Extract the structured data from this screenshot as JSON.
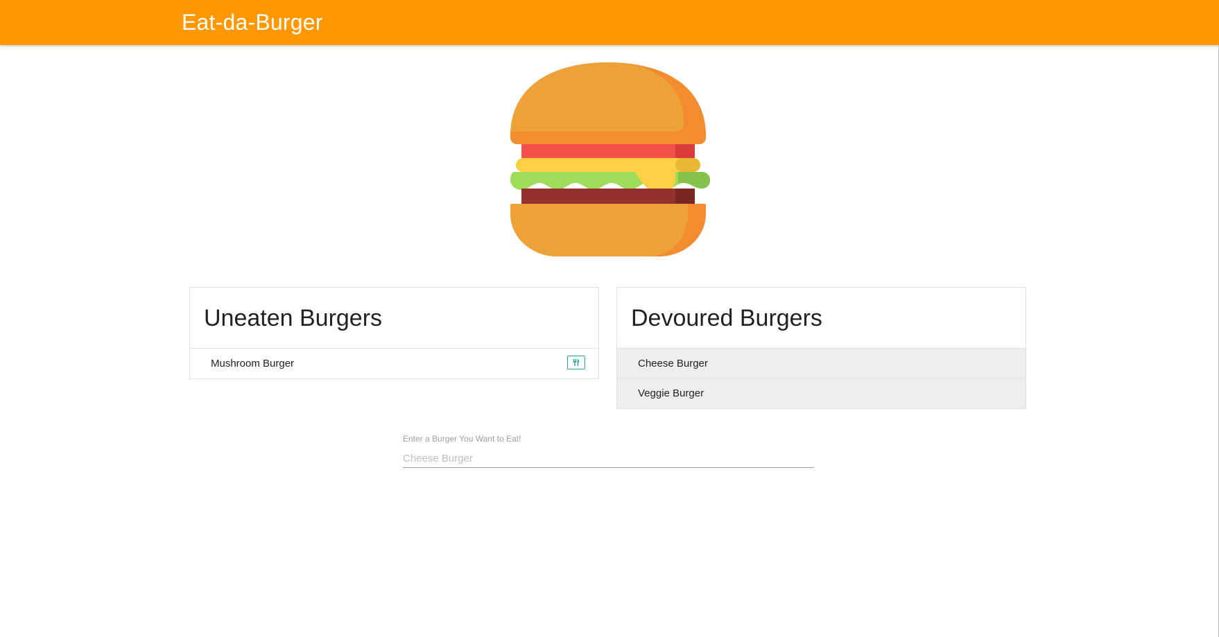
{
  "navbar": {
    "brand": "Eat-da-Burger",
    "color": "#ff9800"
  },
  "hero": {
    "icon": "burger-icon"
  },
  "uneaten": {
    "title": "Uneaten Burgers",
    "items": [
      {
        "name": "Mushroom Burger",
        "action_icon": "fork-knife-icon"
      }
    ]
  },
  "devoured": {
    "title": "Devoured Burgers",
    "items": [
      {
        "name": "Cheese Burger"
      },
      {
        "name": "Veggie Burger"
      }
    ]
  },
  "form": {
    "label": "Enter a Burger You Want to Eat!",
    "placeholder": "Cheese Burger",
    "value": ""
  },
  "colors": {
    "accent": "#ff9800",
    "button_border": "#26a69a",
    "devoured_bg": "#eeeeee"
  }
}
